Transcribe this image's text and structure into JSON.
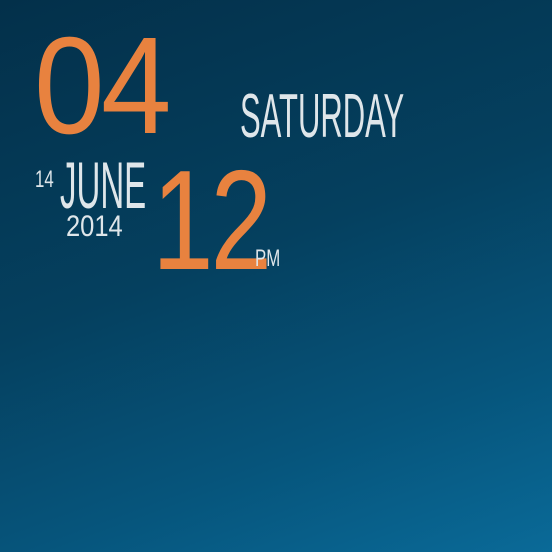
{
  "clock": {
    "minutes": "04",
    "weekday": "SATURDAY",
    "day": "14",
    "month": "JUNE",
    "year": "2014",
    "hour": "12",
    "ampm": "pm"
  },
  "colors": {
    "accent": "#e8823f",
    "text": "#dfe6ea",
    "background_top": "#03304a",
    "background_bottom": "#0a6a98"
  }
}
